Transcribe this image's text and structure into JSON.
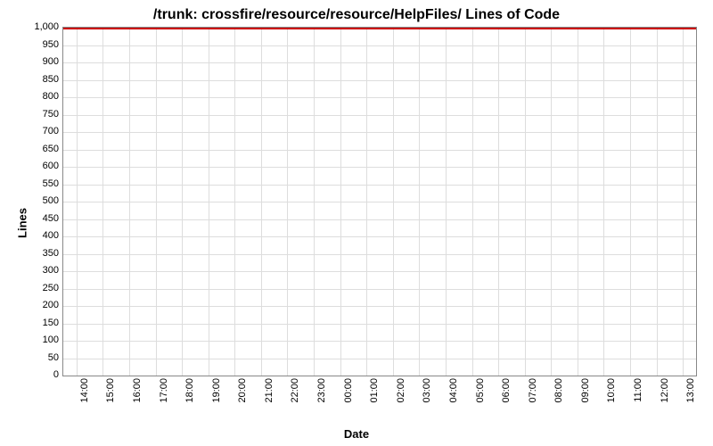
{
  "chart_data": {
    "type": "line",
    "title": "/trunk: crossfire/resource/resource/HelpFiles/ Lines of Code",
    "xlabel": "Date",
    "ylabel": "Lines",
    "ylim": [
      0,
      1000
    ],
    "y_ticks": [
      0,
      50,
      100,
      150,
      200,
      250,
      300,
      350,
      400,
      450,
      500,
      550,
      600,
      650,
      700,
      750,
      800,
      850,
      900,
      950,
      1000
    ],
    "y_tick_labels": [
      "0",
      "50",
      "100",
      "150",
      "200",
      "250",
      "300",
      "350",
      "400",
      "450",
      "500",
      "550",
      "600",
      "650",
      "700",
      "750",
      "800",
      "850",
      "900",
      "950",
      "1,000"
    ],
    "x_ticks": [
      "14:00",
      "15:00",
      "16:00",
      "17:00",
      "18:00",
      "19:00",
      "20:00",
      "21:00",
      "22:00",
      "23:00",
      "00:00",
      "01:00",
      "02:00",
      "03:00",
      "04:00",
      "05:00",
      "06:00",
      "07:00",
      "08:00",
      "09:00",
      "10:00",
      "11:00",
      "12:00",
      "13:00"
    ],
    "series": [
      {
        "name": "Lines of Code",
        "color": "#cc0000",
        "values": [
          1000,
          1000,
          1000,
          1000,
          1000,
          1000,
          1000,
          1000,
          1000,
          1000,
          1000,
          1000,
          1000,
          1000,
          1000,
          1000,
          1000,
          1000,
          1000,
          1000,
          1000,
          1000,
          1000,
          1000
        ]
      }
    ]
  }
}
